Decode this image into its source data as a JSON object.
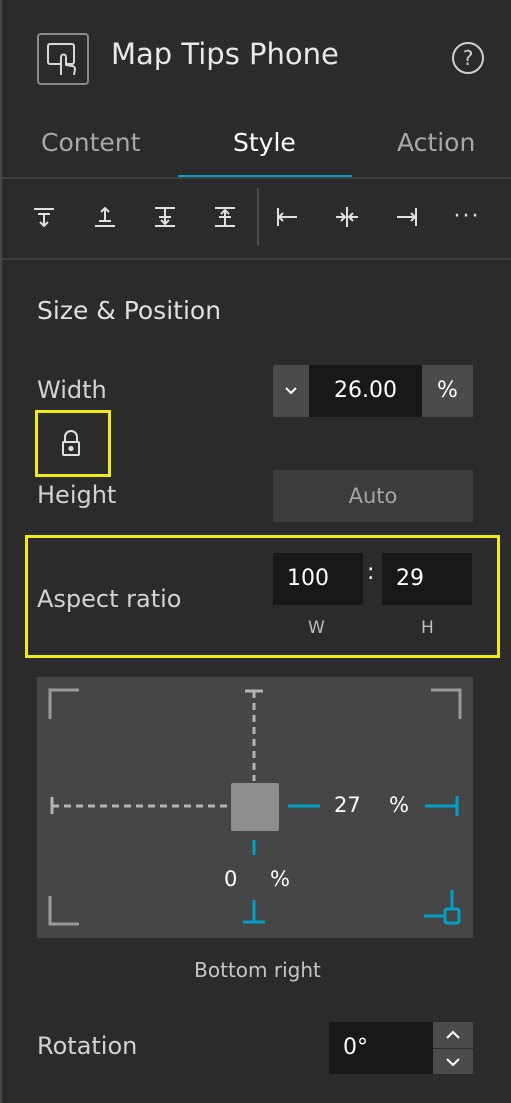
{
  "header": {
    "title": "Map Tips Phone",
    "icon": "touch-gesture-icon",
    "help_icon": "?"
  },
  "tabs": [
    {
      "label": "Content",
      "active": false
    },
    {
      "label": "Style",
      "active": true
    },
    {
      "label": "Action",
      "active": false
    }
  ],
  "toolbar": {
    "icons": [
      "align-top-icon",
      "align-vertical-center-icon",
      "align-bottom-icon",
      "distribute-vertical-icon",
      "align-left-icon",
      "align-horizontal-center-icon",
      "align-right-icon",
      "more-icon"
    ],
    "more_label": "···"
  },
  "section": {
    "title": "Size & Position",
    "width": {
      "label": "Width",
      "value": "26.00",
      "unit": "%"
    },
    "height": {
      "label": "Height",
      "value": "Auto"
    },
    "aspect": {
      "label": "Aspect ratio",
      "w": "100",
      "h": "29",
      "separator": ":",
      "w_label": "W",
      "h_label": "H"
    },
    "position": {
      "right_value": "27",
      "right_unit": "%",
      "bottom_value": "0",
      "bottom_unit": "%",
      "anchor": "Bottom right"
    },
    "rotation": {
      "label": "Rotation",
      "value": "0°"
    }
  },
  "colors": {
    "accent": "#00a0c6",
    "highlight": "#f0eb17",
    "background": "#2b2b2b"
  }
}
